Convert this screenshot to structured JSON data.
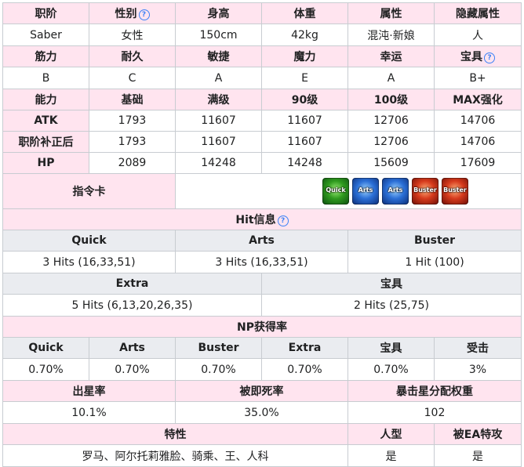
{
  "basic": {
    "headers": [
      "职阶",
      "性别",
      "身高",
      "体重",
      "属性",
      "隐藏属性"
    ],
    "values": [
      "Saber",
      "女性",
      "150cm",
      "42kg",
      "混沌·新娘",
      "人"
    ]
  },
  "params": {
    "headers": [
      "筋力",
      "耐久",
      "敏捷",
      "魔力",
      "幸运",
      "宝具"
    ],
    "values": [
      "B",
      "C",
      "A",
      "E",
      "A",
      "B+"
    ]
  },
  "stats": {
    "headers": [
      "能力",
      "基础",
      "满级",
      "90级",
      "100级",
      "MAX强化"
    ],
    "rows": [
      {
        "label": "ATK",
        "values": [
          "1793",
          "11607",
          "11607",
          "12706",
          "14706"
        ]
      },
      {
        "label": "职阶补正后",
        "values": [
          "1793",
          "11607",
          "11607",
          "12706",
          "14706"
        ]
      },
      {
        "label": "HP",
        "values": [
          "2089",
          "14248",
          "14248",
          "15609",
          "17609"
        ]
      }
    ]
  },
  "command_cards": {
    "label": "指令卡",
    "cards": [
      {
        "type": "quick",
        "text": "Quick",
        "icon": "quick-card-icon"
      },
      {
        "type": "arts",
        "text": "Arts",
        "icon": "arts-card-icon"
      },
      {
        "type": "arts",
        "text": "Arts",
        "icon": "arts-card-icon"
      },
      {
        "type": "buster",
        "text": "Buster",
        "icon": "buster-card-icon"
      },
      {
        "type": "buster",
        "text": "Buster",
        "icon": "buster-card-icon"
      }
    ]
  },
  "hit_info": {
    "title": "Hit信息",
    "row1_headers": [
      "Quick",
      "Arts",
      "Buster"
    ],
    "row1_values": [
      "3 Hits (16,33,51)",
      "3 Hits (16,33,51)",
      "1 Hit (100)"
    ],
    "row2_headers": [
      "Extra",
      "宝具"
    ],
    "row2_values": [
      "5 Hits (6,13,20,26,35)",
      "2 Hits (25,75)"
    ]
  },
  "np_gain": {
    "title": "NP获得率",
    "headers": [
      "Quick",
      "Arts",
      "Buster",
      "Extra",
      "宝具",
      "受击"
    ],
    "values": [
      "0.70%",
      "0.70%",
      "0.70%",
      "0.70%",
      "0.70%",
      "3%"
    ]
  },
  "star": {
    "headers": [
      "出星率",
      "被即死率",
      "暴击星分配权重"
    ],
    "values": [
      "10.1%",
      "35.0%",
      "102"
    ]
  },
  "traits": {
    "headers": [
      "特性",
      "人型",
      "被EA特攻"
    ],
    "values": [
      "罗马、阿尔托莉雅脸、骑乘、王、人科",
      "是",
      "是"
    ]
  },
  "colors": {
    "header_pink": "#ffe4ef",
    "header_grey": "#eaecf0",
    "link_blue": "#3366cc",
    "border": "#c8ccd1"
  }
}
